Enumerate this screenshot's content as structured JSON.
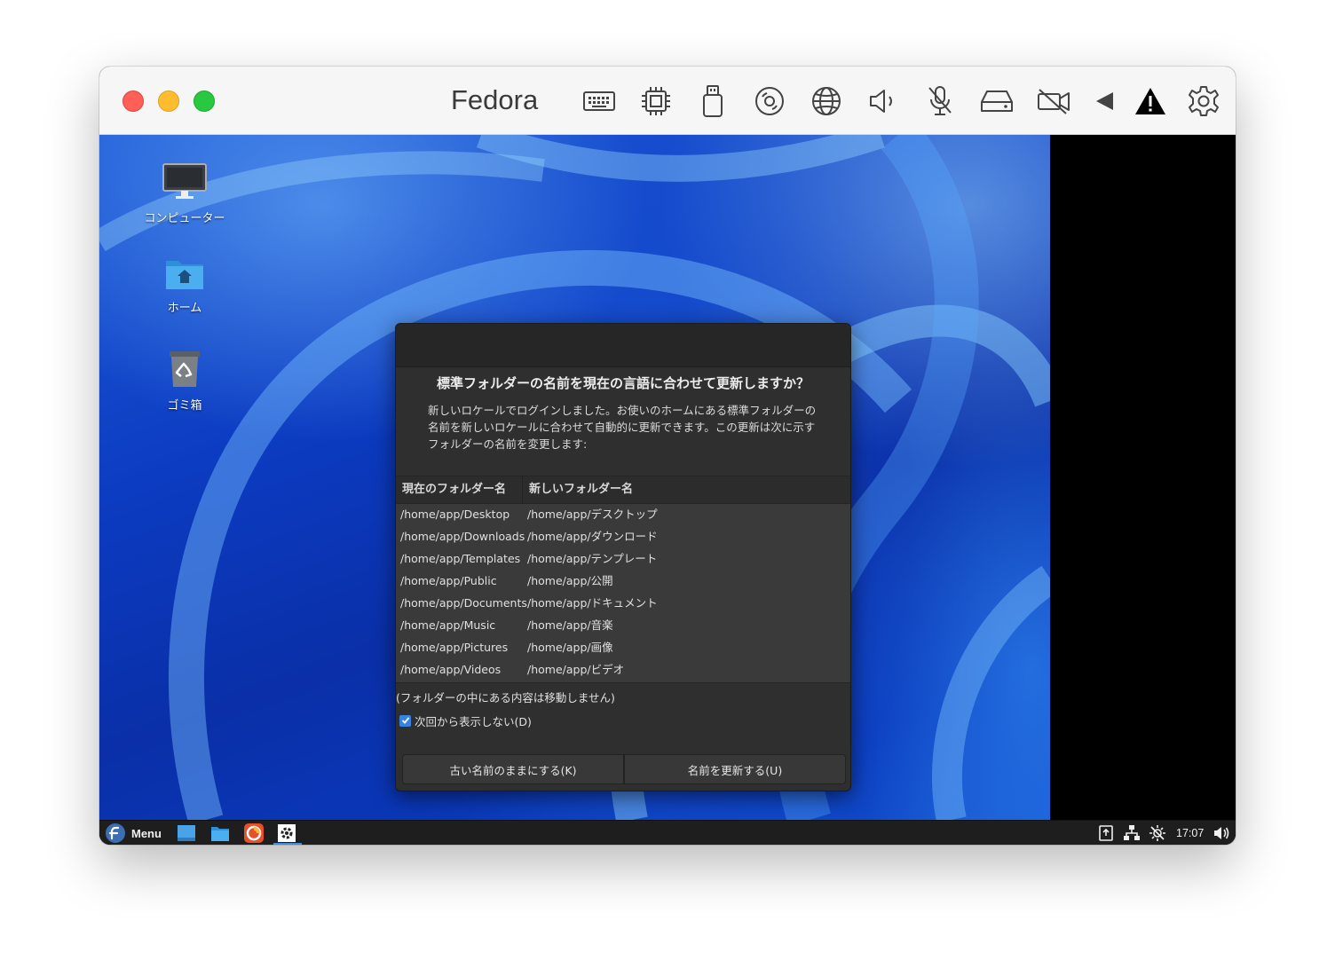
{
  "window": {
    "title": "Fedora"
  },
  "toolbar_icons": [
    "keyboard-icon",
    "cpu-icon",
    "usb-icon",
    "disc-icon",
    "globe-icon",
    "speaker-icon",
    "microphone-muted-icon",
    "drive-icon",
    "camera-off-icon",
    "back-arrow-icon",
    "warning-icon",
    "gear-icon"
  ],
  "desktop": {
    "icons": [
      {
        "label": "コンピューター",
        "icon": "monitor-icon"
      },
      {
        "label": "ホーム",
        "icon": "home-folder-icon"
      },
      {
        "label": "ゴミ箱",
        "icon": "trash-icon"
      }
    ]
  },
  "dialog": {
    "title": "標準フォルダーの名前を現在の言語に合わせて更新しますか？",
    "body": [
      "新しいロケールでログインしました。お使いのホームにある標準フォルダーの",
      "名前を新しいロケールに合わせて自動的に更新できます。この更新は次に示す",
      "フォルダーの名前を変更します:"
    ],
    "columns": [
      "現在のフォルダー名",
      "新しいフォルダー名"
    ],
    "rows": [
      [
        "/home/app/Desktop",
        "/home/app/デスクトップ"
      ],
      [
        "/home/app/Downloads",
        "/home/app/ダウンロード"
      ],
      [
        "/home/app/Templates",
        "/home/app/テンプレート"
      ],
      [
        "/home/app/Public",
        "/home/app/公開"
      ],
      [
        "/home/app/Documents",
        "/home/app/ドキュメント"
      ],
      [
        "/home/app/Music",
        "/home/app/音楽"
      ],
      [
        "/home/app/Pictures",
        "/home/app/画像"
      ],
      [
        "/home/app/Videos",
        "/home/app/ビデオ"
      ]
    ],
    "note": "(フォルダーの中にある内容は移動しません)",
    "checkbox": {
      "label": "次回から表示しない(D)",
      "checked": true
    },
    "buttons": {
      "keep": "古い名前のままにする(K)",
      "update": "名前を更新する(U)"
    }
  },
  "taskbar": {
    "menu_label": "Menu",
    "clock": "17:07",
    "accent_color": "#3c8ce6"
  },
  "colors": {
    "close": "#fe5f57",
    "minimize": "#febc2e",
    "maximize": "#28c840",
    "checkbox": "#3584e4"
  }
}
